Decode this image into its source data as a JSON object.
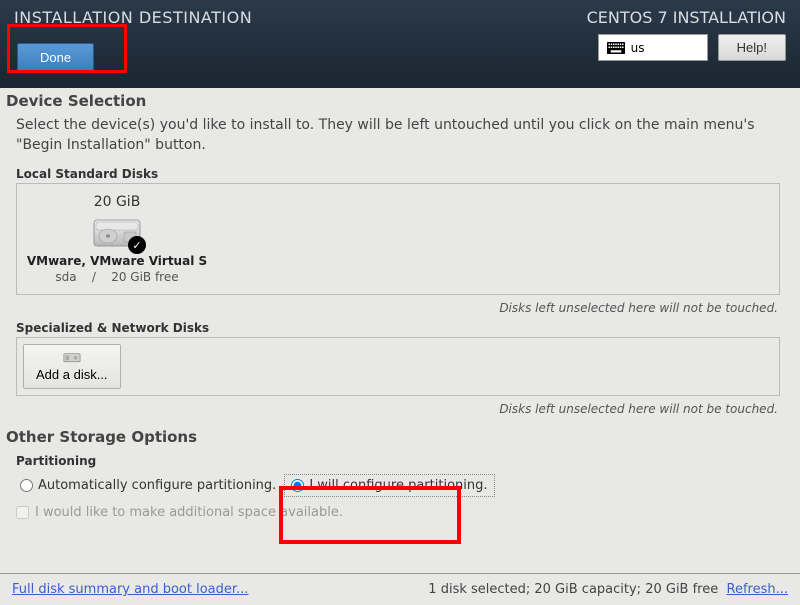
{
  "header": {
    "title": "INSTALLATION DESTINATION",
    "installer_title": "CENTOS 7 INSTALLATION",
    "done_label": "Done",
    "help_label": "Help!",
    "lang_code": "us"
  },
  "device_selection": {
    "title": "Device Selection",
    "instruction": "Select the device(s) you'd like to install to.  They will be left untouched until you click on the main menu's \"Begin Installation\" button."
  },
  "local_disks": {
    "section_label": "Local Standard Disks",
    "disk": {
      "size": "20 GiB",
      "name": "VMware, VMware Virtual S",
      "dev": "sda",
      "sep": "/",
      "free": "20 GiB free"
    },
    "hint": "Disks left unselected here will not be touched."
  },
  "network_disks": {
    "section_label": "Specialized & Network Disks",
    "add_label": "Add a disk...",
    "hint": "Disks left unselected here will not be touched."
  },
  "other_storage": {
    "title": "Other Storage Options",
    "partitioning_label": "Partitioning",
    "auto_label": "Automatically configure partitioning.",
    "manual_label": "I will configure partitioning.",
    "additional_space_label": "I would like to make additional space available."
  },
  "footer": {
    "summary_link": "Full disk summary and boot loader...",
    "status": "1 disk selected; 20 GiB capacity; 20 GiB free",
    "refresh_link": "Refresh..."
  }
}
